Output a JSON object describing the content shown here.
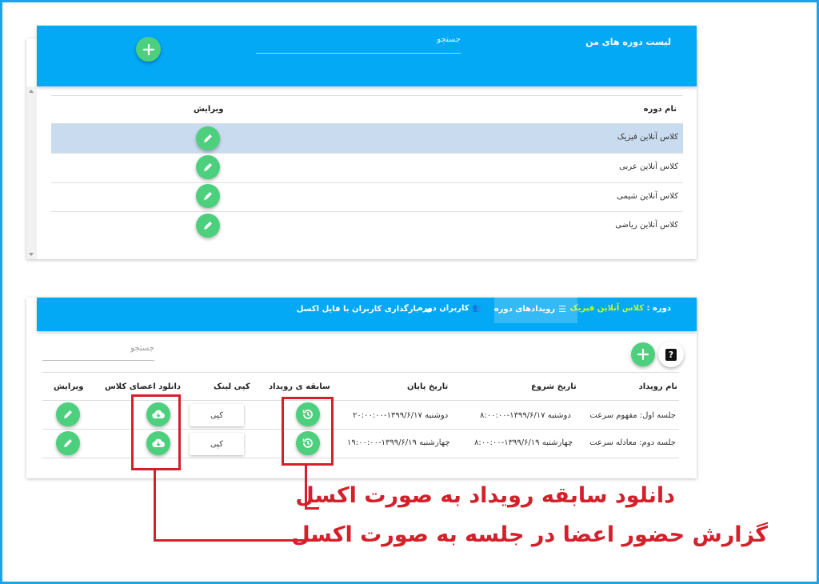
{
  "colors": {
    "frame": "#1aa3e6",
    "bar": "#03a9f4",
    "fab": "#4cd07d",
    "selected_row": "#c9dcef",
    "annotation": "#d3202b",
    "course_green": "#c6ff00"
  },
  "courses_panel": {
    "title": "لیست دوره های من",
    "search_placeholder": "جستجو",
    "add_icon": "plus-icon",
    "columns": {
      "name": "نام دوره",
      "edit": "ویرایش"
    },
    "rows": [
      {
        "name": "کلاس آنلاین فیزیک",
        "selected": true
      },
      {
        "name": "کلاس آنلاین عربی",
        "selected": false
      },
      {
        "name": "کلاس آنلاین شیمی",
        "selected": false
      },
      {
        "name": "کلاس آنلاین ریاضی",
        "selected": false
      }
    ]
  },
  "events_panel": {
    "course_label": "دوره :",
    "course_name": "کلاس آنلاین فیزیک",
    "tabs": [
      {
        "label": "رویدادهای دوره",
        "icon": "list-icon",
        "active": true
      },
      {
        "label": "کاربران دوره",
        "icon": "people-icon",
        "active": false
      },
      {
        "label": "بارگذاری کاربران با فایل اکسل",
        "icon": "cloud-icon",
        "active": false
      }
    ],
    "search_placeholder": "جستجو",
    "columns": {
      "name": "نام رویداد",
      "start": "تاریخ شروع",
      "end": "تاریخ پایان",
      "history": "سابقه ی رویداد",
      "copy": "کپی لینک",
      "download": "دانلود اعضای کلاس",
      "edit": "ویرایش"
    },
    "rows": [
      {
        "name": "جلسه اول: مفهوم سرعت",
        "start": "دوشنبه ۱۳۹۹/۶/۱۷-۸:۰۰:۰۰",
        "end": "دوشنبه ۱۳۹۹/۶/۱۷-۲۰:۰۰:۰۰",
        "copy": "کپی"
      },
      {
        "name": "جلسه دوم: معادله سرعت",
        "start": "چهارشنبه ۱۳۹۹/۶/۱۹-۸:۰۰:۰۰",
        "end": "چهارشنبه ۱۳۹۹/۶/۱۹-۱۹:۰۰:۰۰",
        "copy": "کپی"
      }
    ]
  },
  "annotations": {
    "history_note": "دانلود سابقه رویداد به صورت اکسل",
    "attendance_note": "گزارش حضور اعضا در جلسه به صورت اکسل"
  }
}
